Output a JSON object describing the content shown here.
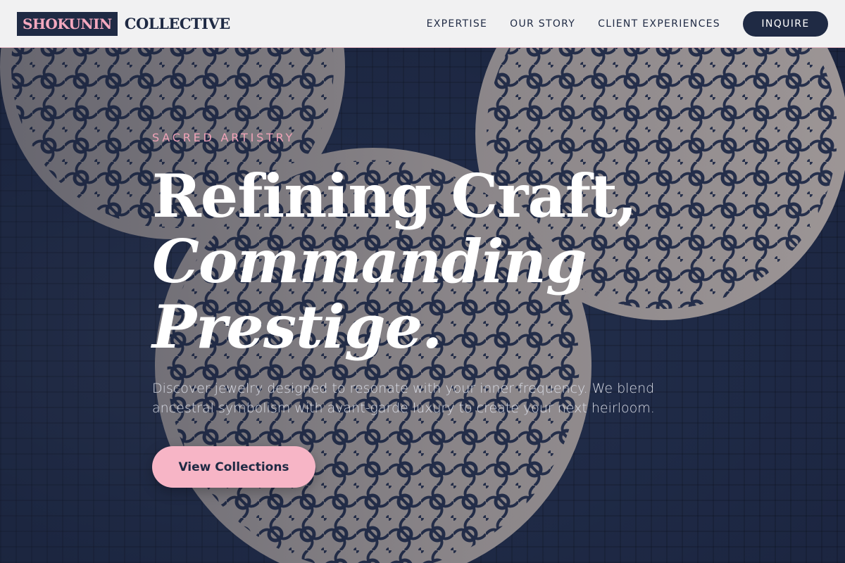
{
  "brand": {
    "mark": "SHOKUNIN",
    "name": "COLLECTIVE"
  },
  "nav": {
    "items": [
      {
        "label": "EXPERTISE"
      },
      {
        "label": "OUR STORY"
      },
      {
        "label": "CLIENT EXPERIENCES"
      }
    ],
    "cta_label": "INQUIRE"
  },
  "hero": {
    "eyebrow": "SACRED ARTISTRY",
    "headline": {
      "line1": "Refining Craft,",
      "line2": "Commanding",
      "line3": "Prestige."
    },
    "lede": "Discover jewelry designed to resonate with your inner frequency. We blend ancestral symbolism with avant-garde luxury to create your next heirloom.",
    "cta_label": "View Collections",
    "background_image": "filigree-pendants-photo"
  },
  "colors": {
    "navy": "#1f2a44",
    "pink": "#f7b5c6",
    "accent_text": "#f0a3b8",
    "nav_bg": "#f1f1f2"
  }
}
